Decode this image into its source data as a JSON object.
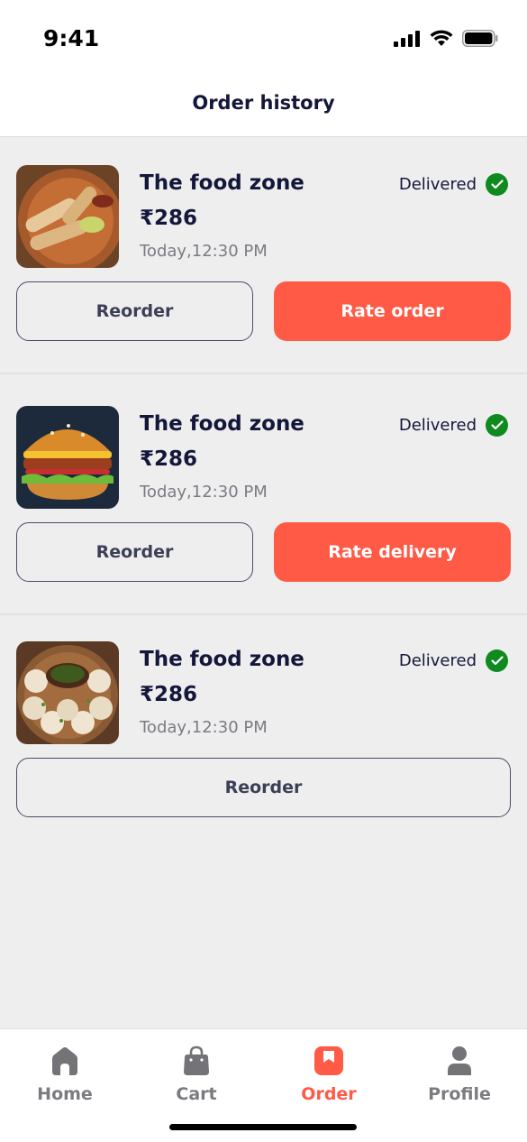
{
  "status_bar": {
    "time": "9:41"
  },
  "header": {
    "title": "Order history"
  },
  "orders": [
    {
      "image": "rolls-food-photo",
      "restaurant": "The food zone",
      "price": "₹286",
      "time": "Today,12:30 PM",
      "status": "Delivered",
      "buttons": [
        "Reorder",
        "Rate order"
      ]
    },
    {
      "image": "burger-food-photo",
      "restaurant": "The food zone",
      "price": "₹286",
      "time": "Today,12:30 PM",
      "status": "Delivered",
      "buttons": [
        "Reorder",
        "Rate delivery"
      ]
    },
    {
      "image": "momos-food-photo",
      "restaurant": "The food zone",
      "price": "₹286",
      "time": "Today,12:30 PM",
      "status": "Delivered",
      "buttons": [
        "Reorder"
      ]
    }
  ],
  "nav": {
    "active": "Order",
    "items": [
      {
        "label": "Home",
        "icon": "home-icon"
      },
      {
        "label": "Cart",
        "icon": "bag-icon"
      },
      {
        "label": "Order",
        "icon": "bookmark-icon"
      },
      {
        "label": "Profile",
        "icon": "person-icon"
      }
    ]
  },
  "colors": {
    "accent": "#fe5a45",
    "delivered": "#0f8a1f",
    "text": "#14163a"
  }
}
